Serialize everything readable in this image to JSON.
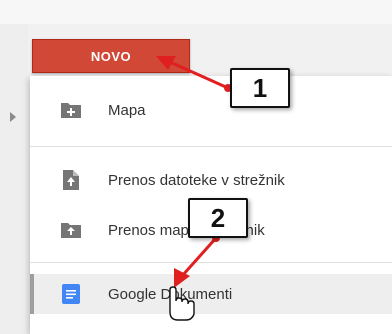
{
  "new_button": {
    "label": "NOVO"
  },
  "menu": {
    "items": [
      {
        "label": "Mapa",
        "icon": "folder-plus-icon"
      },
      {
        "label": "Prenos datoteke v strežnik",
        "icon": "file-upload-icon"
      },
      {
        "label": "Prenos mape v strežnik",
        "icon": "folder-upload-icon"
      },
      {
        "label": "Google Dokumenti",
        "icon": "google-docs-icon"
      }
    ]
  },
  "callouts": [
    {
      "number": "1"
    },
    {
      "number": "2"
    }
  ],
  "colors": {
    "new_button": "#d14836",
    "arrow": "#e02020",
    "docs_icon": "#4285f4",
    "icon_gray": "#757575"
  }
}
